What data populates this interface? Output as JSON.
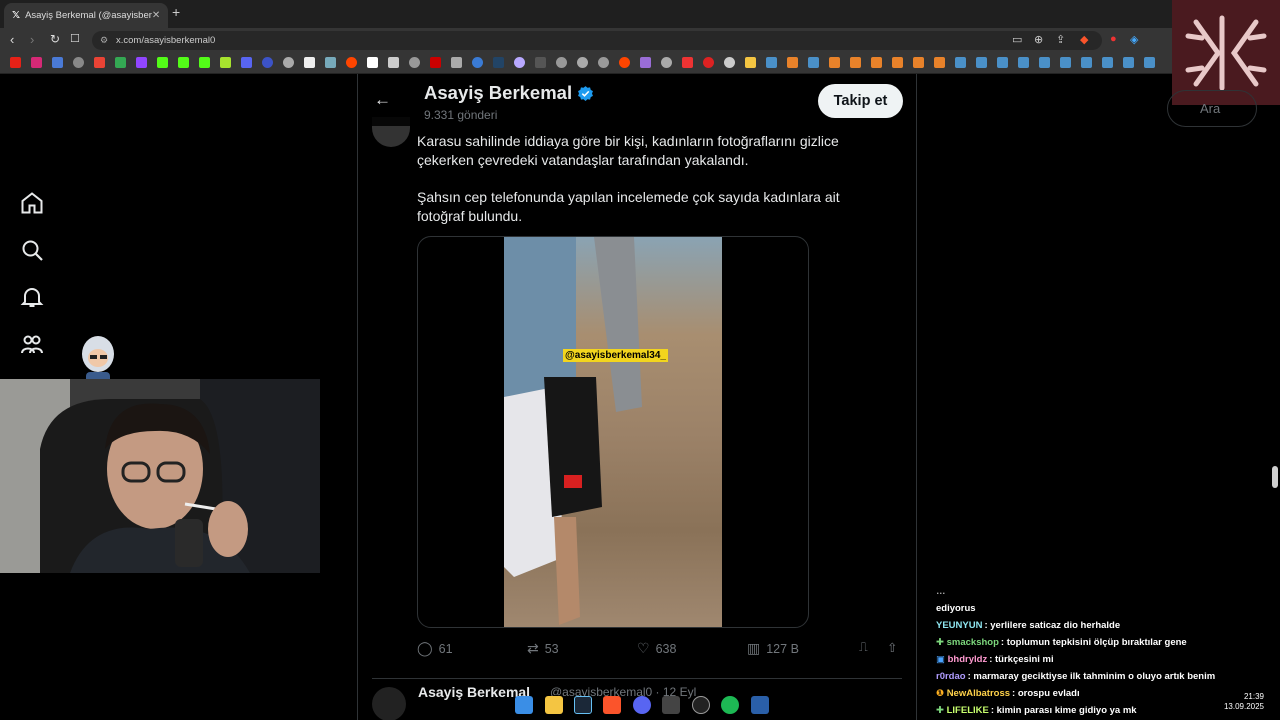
{
  "browser": {
    "tab_title": "Asayiş Berkemal (@asayisber",
    "url": "x.com/asayisberkemal0"
  },
  "header": {
    "name": "Asayiş Berkemal",
    "posts": "9.331 gönderi",
    "follow_label": "Takip et"
  },
  "tweet": {
    "para1": "Karasu sahilinde iddiaya göre bir kişi, kadınların fotoğraflarını gizlice çekerken çevredeki vatandaşlar tarafından yakalandı.",
    "para2": "Şahsın cep telefonunda yapılan incelemede çok sayıda kadınlara ait fotoğraf bulundu.",
    "watermark": "@asayisberkemal34_",
    "replies": "61",
    "reposts": "53",
    "likes": "638",
    "views": "127 B"
  },
  "next_tweet": {
    "name": "Asayiş Berkemal",
    "handle": "@asayisberkemal0 · 12 Eyl"
  },
  "search": {
    "placeholder": "Ara"
  },
  "chat": [
    {
      "user": "",
      "user_color": "#c080ff",
      "text": "",
      "raw": "ediyorus"
    },
    {
      "user": "YEUNYUN",
      "user_color": "#8ee6f0",
      "text": ": yerlilere saticaz dio herhalde"
    },
    {
      "user": "smackshop",
      "user_color": "#7dd87d",
      "text": ": toplumun tepkisini ölçüp bıraktılar gene"
    },
    {
      "user": "bhdryldz",
      "user_color": "#ff9ad0",
      "text": ": türkçesini mi"
    },
    {
      "user": "r0rdao",
      "user_color": "#b09cff",
      "text": ": marmaray geciktiyse ilk tahminim o oluyo artık benim"
    },
    {
      "user": "NewAlbatross",
      "user_color": "#ffd24a",
      "text": ": orospu evladı"
    },
    {
      "user": "LIFELIKE",
      "user_color": "#c8ff6e",
      "text": ": kimin parası kime gidiyo ya mk"
    }
  ],
  "clock": {
    "time": "21:39",
    "date": "13.09.2025"
  },
  "colors": {
    "accent": "#1d9bf0",
    "muted": "#71767b",
    "border": "#2f3336"
  }
}
